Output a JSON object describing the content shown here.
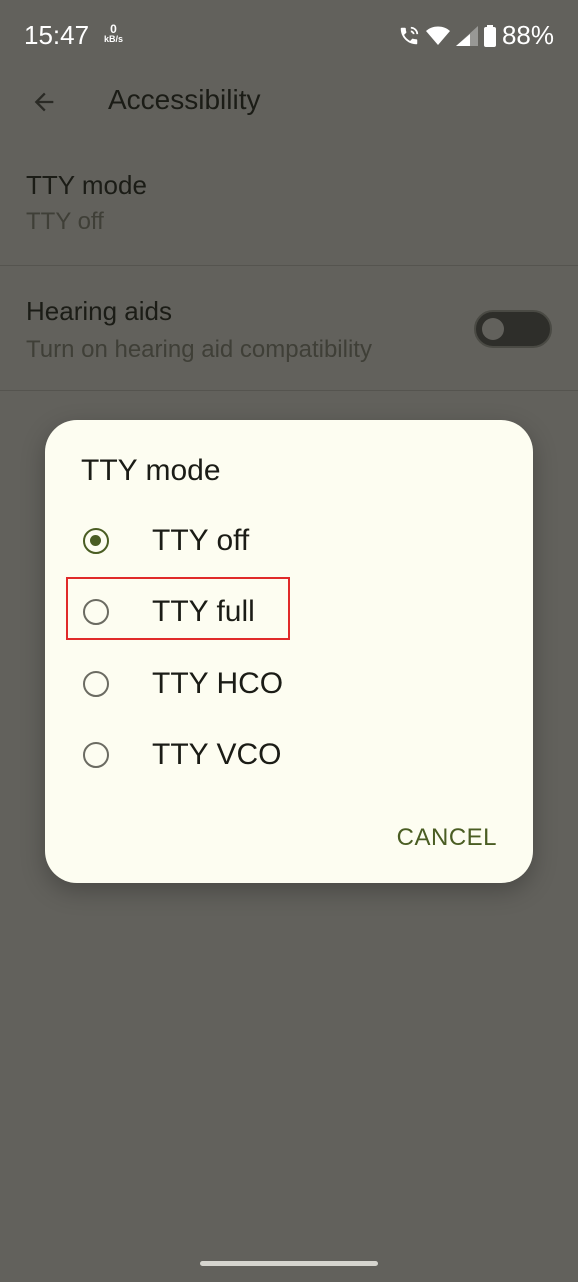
{
  "status_bar": {
    "time": "15:47",
    "net_speed_value": "0",
    "net_speed_unit": "kB/s",
    "battery": "88%"
  },
  "app_bar": {
    "title": "Accessibility"
  },
  "settings": {
    "tty_mode": {
      "title": "TTY mode",
      "summary": "TTY off"
    },
    "hearing_aids": {
      "title": "Hearing aids",
      "summary": "Turn on hearing aid compatibility",
      "enabled": false
    }
  },
  "dialog": {
    "title": "TTY mode",
    "options": [
      {
        "label": "TTY off",
        "selected": true
      },
      {
        "label": "TTY full",
        "selected": false
      },
      {
        "label": "TTY HCO",
        "selected": false
      },
      {
        "label": "TTY VCO",
        "selected": false
      }
    ],
    "cancel_label": "CANCEL"
  },
  "colors": {
    "scrim_background": "#62615c",
    "dialog_background": "#fdfdf1",
    "accent": "#4a5d23",
    "highlight_box": "#e02a2a"
  }
}
